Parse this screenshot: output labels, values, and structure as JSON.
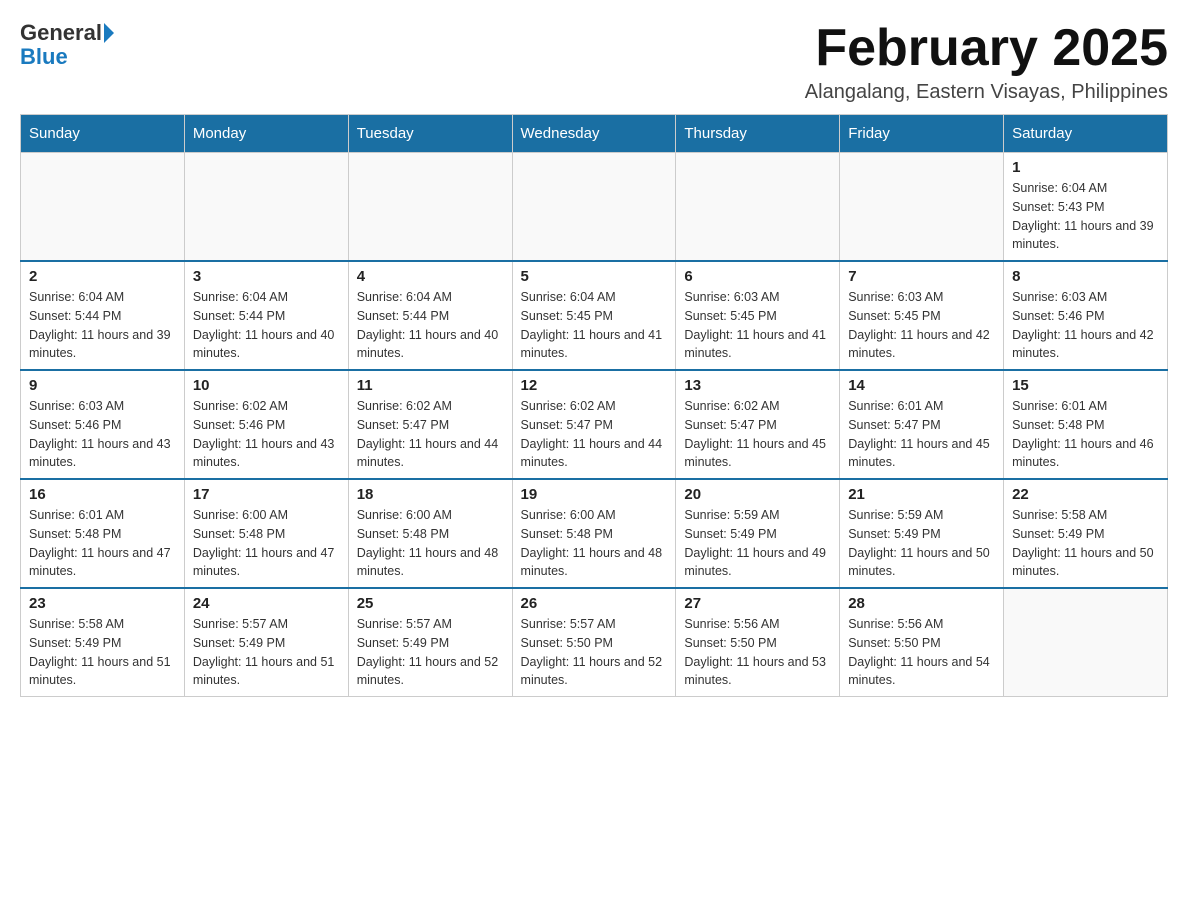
{
  "header": {
    "logo_general": "General",
    "logo_blue": "Blue",
    "month_title": "February 2025",
    "location": "Alangalang, Eastern Visayas, Philippines"
  },
  "days_of_week": [
    "Sunday",
    "Monday",
    "Tuesday",
    "Wednesday",
    "Thursday",
    "Friday",
    "Saturday"
  ],
  "weeks": [
    [
      {
        "day": "",
        "info": ""
      },
      {
        "day": "",
        "info": ""
      },
      {
        "day": "",
        "info": ""
      },
      {
        "day": "",
        "info": ""
      },
      {
        "day": "",
        "info": ""
      },
      {
        "day": "",
        "info": ""
      },
      {
        "day": "1",
        "info": "Sunrise: 6:04 AM\nSunset: 5:43 PM\nDaylight: 11 hours and 39 minutes."
      }
    ],
    [
      {
        "day": "2",
        "info": "Sunrise: 6:04 AM\nSunset: 5:44 PM\nDaylight: 11 hours and 39 minutes."
      },
      {
        "day": "3",
        "info": "Sunrise: 6:04 AM\nSunset: 5:44 PM\nDaylight: 11 hours and 40 minutes."
      },
      {
        "day": "4",
        "info": "Sunrise: 6:04 AM\nSunset: 5:44 PM\nDaylight: 11 hours and 40 minutes."
      },
      {
        "day": "5",
        "info": "Sunrise: 6:04 AM\nSunset: 5:45 PM\nDaylight: 11 hours and 41 minutes."
      },
      {
        "day": "6",
        "info": "Sunrise: 6:03 AM\nSunset: 5:45 PM\nDaylight: 11 hours and 41 minutes."
      },
      {
        "day": "7",
        "info": "Sunrise: 6:03 AM\nSunset: 5:45 PM\nDaylight: 11 hours and 42 minutes."
      },
      {
        "day": "8",
        "info": "Sunrise: 6:03 AM\nSunset: 5:46 PM\nDaylight: 11 hours and 42 minutes."
      }
    ],
    [
      {
        "day": "9",
        "info": "Sunrise: 6:03 AM\nSunset: 5:46 PM\nDaylight: 11 hours and 43 minutes."
      },
      {
        "day": "10",
        "info": "Sunrise: 6:02 AM\nSunset: 5:46 PM\nDaylight: 11 hours and 43 minutes."
      },
      {
        "day": "11",
        "info": "Sunrise: 6:02 AM\nSunset: 5:47 PM\nDaylight: 11 hours and 44 minutes."
      },
      {
        "day": "12",
        "info": "Sunrise: 6:02 AM\nSunset: 5:47 PM\nDaylight: 11 hours and 44 minutes."
      },
      {
        "day": "13",
        "info": "Sunrise: 6:02 AM\nSunset: 5:47 PM\nDaylight: 11 hours and 45 minutes."
      },
      {
        "day": "14",
        "info": "Sunrise: 6:01 AM\nSunset: 5:47 PM\nDaylight: 11 hours and 45 minutes."
      },
      {
        "day": "15",
        "info": "Sunrise: 6:01 AM\nSunset: 5:48 PM\nDaylight: 11 hours and 46 minutes."
      }
    ],
    [
      {
        "day": "16",
        "info": "Sunrise: 6:01 AM\nSunset: 5:48 PM\nDaylight: 11 hours and 47 minutes."
      },
      {
        "day": "17",
        "info": "Sunrise: 6:00 AM\nSunset: 5:48 PM\nDaylight: 11 hours and 47 minutes."
      },
      {
        "day": "18",
        "info": "Sunrise: 6:00 AM\nSunset: 5:48 PM\nDaylight: 11 hours and 48 minutes."
      },
      {
        "day": "19",
        "info": "Sunrise: 6:00 AM\nSunset: 5:48 PM\nDaylight: 11 hours and 48 minutes."
      },
      {
        "day": "20",
        "info": "Sunrise: 5:59 AM\nSunset: 5:49 PM\nDaylight: 11 hours and 49 minutes."
      },
      {
        "day": "21",
        "info": "Sunrise: 5:59 AM\nSunset: 5:49 PM\nDaylight: 11 hours and 50 minutes."
      },
      {
        "day": "22",
        "info": "Sunrise: 5:58 AM\nSunset: 5:49 PM\nDaylight: 11 hours and 50 minutes."
      }
    ],
    [
      {
        "day": "23",
        "info": "Sunrise: 5:58 AM\nSunset: 5:49 PM\nDaylight: 11 hours and 51 minutes."
      },
      {
        "day": "24",
        "info": "Sunrise: 5:57 AM\nSunset: 5:49 PM\nDaylight: 11 hours and 51 minutes."
      },
      {
        "day": "25",
        "info": "Sunrise: 5:57 AM\nSunset: 5:49 PM\nDaylight: 11 hours and 52 minutes."
      },
      {
        "day": "26",
        "info": "Sunrise: 5:57 AM\nSunset: 5:50 PM\nDaylight: 11 hours and 52 minutes."
      },
      {
        "day": "27",
        "info": "Sunrise: 5:56 AM\nSunset: 5:50 PM\nDaylight: 11 hours and 53 minutes."
      },
      {
        "day": "28",
        "info": "Sunrise: 5:56 AM\nSunset: 5:50 PM\nDaylight: 11 hours and 54 minutes."
      },
      {
        "day": "",
        "info": ""
      }
    ]
  ]
}
